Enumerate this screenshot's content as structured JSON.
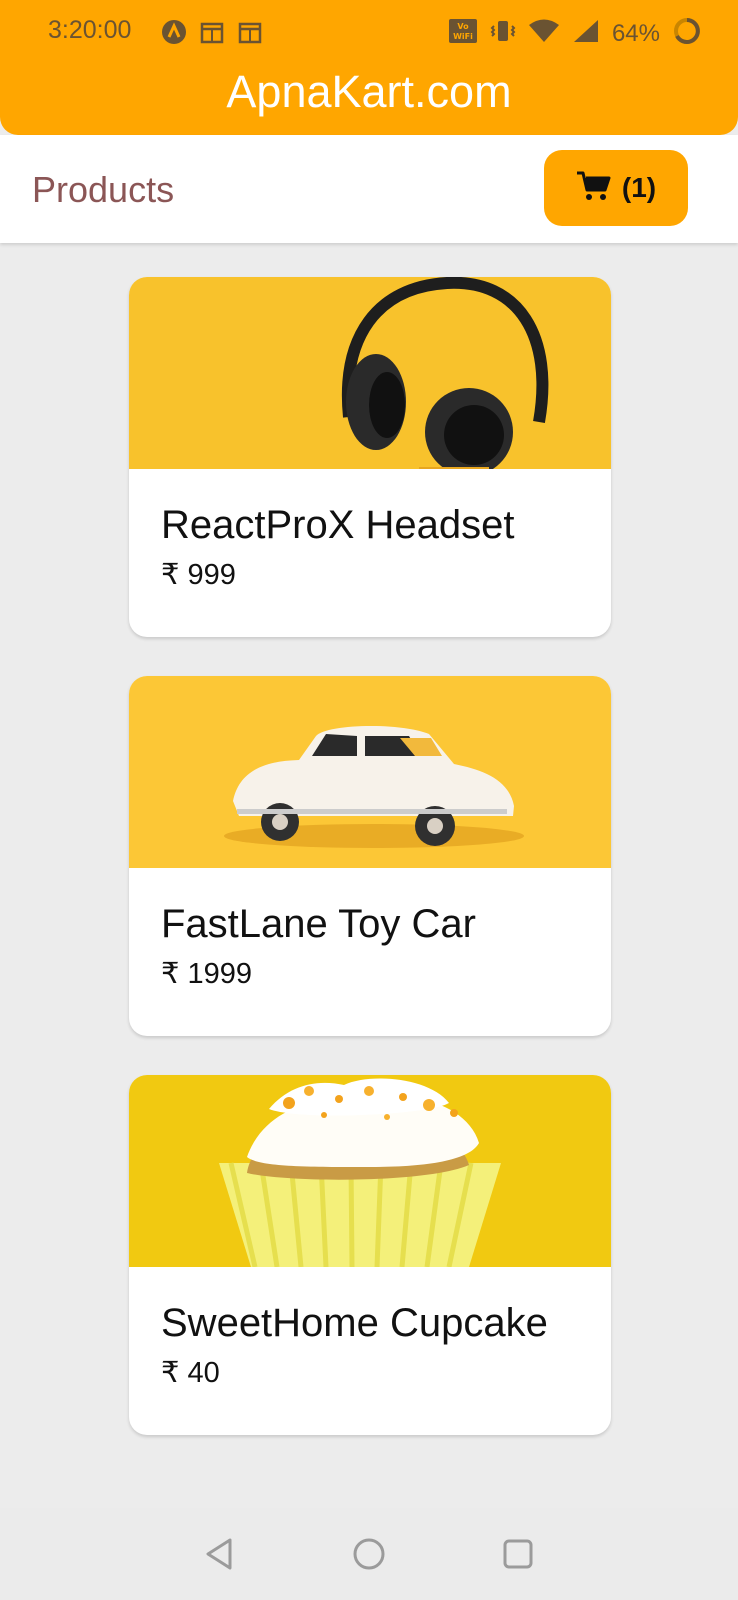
{
  "status_bar": {
    "time": "3:20:00",
    "battery": "64%",
    "wifi_label_top": "Vo",
    "wifi_label_bottom": "WiFi"
  },
  "app": {
    "title": "ApnaKart.com"
  },
  "subheader": {
    "title": "Products",
    "cart_count": "(1)"
  },
  "products": [
    {
      "name": "ReactProX Headset",
      "price": "₹ 999"
    },
    {
      "name": "FastLane Toy Car",
      "price": "₹ 1999"
    },
    {
      "name": "SweetHome Cupcake",
      "price": "₹ 40"
    }
  ],
  "colors": {
    "brand": "#ffa600",
    "page_background": "#ececec",
    "products_title": "#8b5656",
    "text": "#111111"
  },
  "icons": {
    "cart": "cart-icon",
    "nav_back": "back-triangle-icon",
    "nav_home": "home-circle-icon",
    "nav_recents": "recents-square-icon"
  }
}
